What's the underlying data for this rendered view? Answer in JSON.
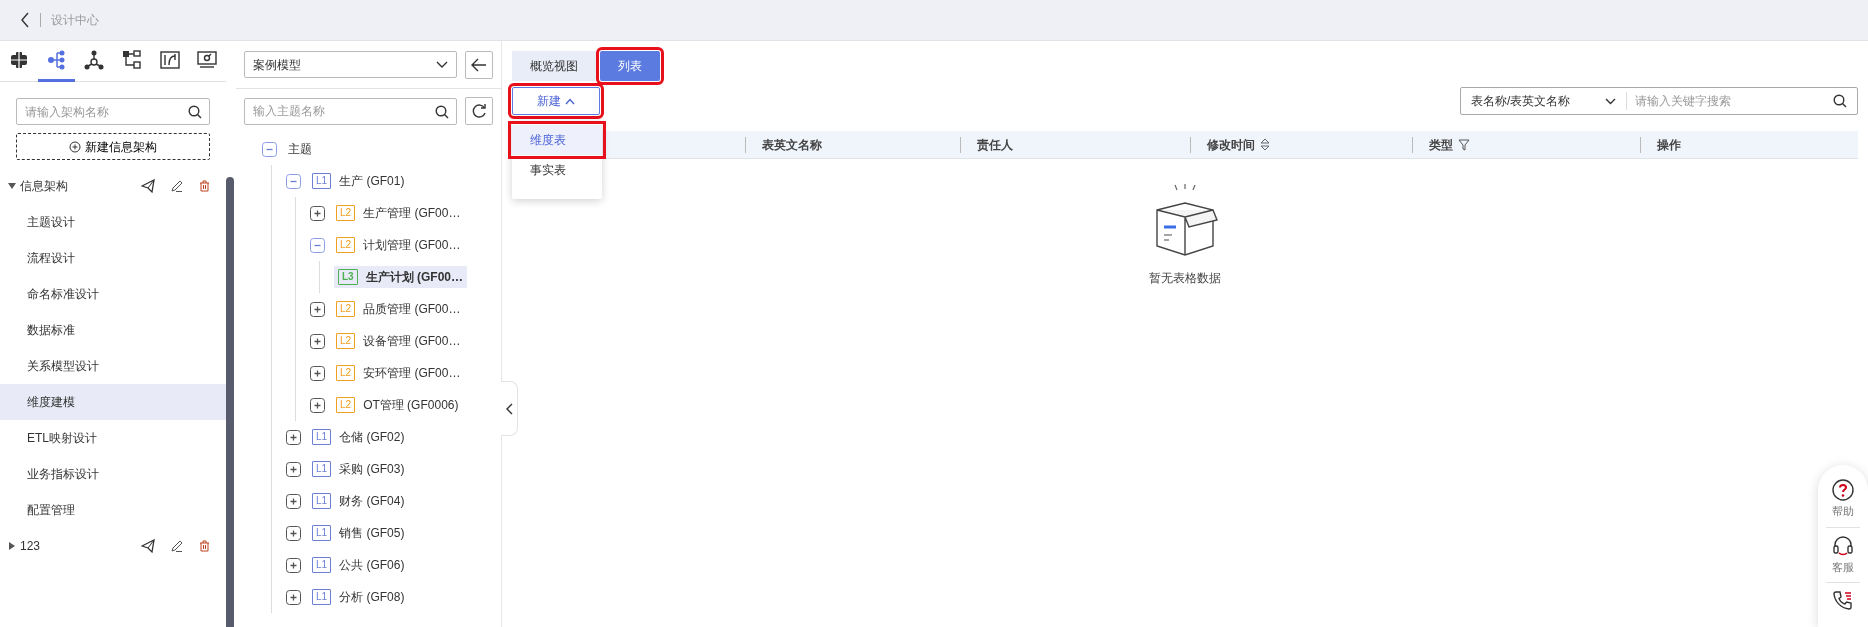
{
  "header": {
    "breadcrumb": "设计中心"
  },
  "sidebar": {
    "icon_tabs": [
      {
        "selected": false
      },
      {
        "selected": true
      },
      {
        "selected": false
      },
      {
        "selected": false
      },
      {
        "selected": false
      },
      {
        "selected": false
      }
    ],
    "search": {
      "placeholder": "请输入架构名称"
    },
    "new_button": "新建信息架构",
    "architectures": [
      {
        "label": "信息架构",
        "expanded": true,
        "items": [
          {
            "label": "主题设计",
            "selected": false
          },
          {
            "label": "流程设计",
            "selected": false
          },
          {
            "label": "命名标准设计",
            "selected": false
          },
          {
            "label": "数据标准",
            "selected": false
          },
          {
            "label": "关系模型设计",
            "selected": false
          },
          {
            "label": "维度建模",
            "selected": true
          },
          {
            "label": "ETL映射设计",
            "selected": false
          },
          {
            "label": "业务指标设计",
            "selected": false
          },
          {
            "label": "配置管理",
            "selected": false
          }
        ]
      },
      {
        "label": "123",
        "expanded": false
      }
    ]
  },
  "subject_panel": {
    "model_select": "案例模型",
    "search": {
      "placeholder": "输入主题名称"
    },
    "tree": [
      {
        "label": "主题",
        "expanded": true,
        "selected": false,
        "children": [
          {
            "label": "生产 (GF01)",
            "level": "L1",
            "expanded": true,
            "selected": false,
            "children": [
              {
                "label": "生产管理 (GF00…",
                "level": "L2",
                "expanded": false,
                "selected": false
              },
              {
                "label": "计划管理 (GF00…",
                "level": "L2",
                "expanded": true,
                "selected": false,
                "children": [
                  {
                    "label": "生产计划 (GF00…",
                    "level": "L3",
                    "selected": true
                  }
                ]
              },
              {
                "label": "品质管理 (GF00…",
                "level": "L2",
                "expanded": false,
                "selected": false
              },
              {
                "label": "设备管理 (GF00…",
                "level": "L2",
                "expanded": false,
                "selected": false
              },
              {
                "label": "安环管理 (GF00…",
                "level": "L2",
                "expanded": false,
                "selected": false
              },
              {
                "label": "OT管理 (GF0006)",
                "level": "L2",
                "expanded": false,
                "selected": false
              }
            ]
          },
          {
            "label": "仓储 (GF02)",
            "level": "L1",
            "expanded": false,
            "selected": false
          },
          {
            "label": "采购 (GF03)",
            "level": "L1",
            "expanded": false,
            "selected": false
          },
          {
            "label": "财务 (GF04)",
            "level": "L1",
            "expanded": false,
            "selected": false
          },
          {
            "label": "销售 (GF05)",
            "level": "L1",
            "expanded": false,
            "selected": false
          },
          {
            "label": "公共 (GF06)",
            "level": "L1",
            "expanded": false,
            "selected": false
          },
          {
            "label": "分析 (GF08)",
            "level": "L1",
            "expanded": false,
            "selected": false
          }
        ]
      }
    ]
  },
  "content": {
    "tabs": [
      {
        "label": "概览视图",
        "selected": false,
        "highlighted": false
      },
      {
        "label": "列表",
        "selected": true,
        "highlighted": true
      }
    ],
    "new_button": {
      "label": "新建",
      "expanded": true,
      "highlighted": true
    },
    "new_menu": [
      {
        "label": "维度表",
        "selected": true,
        "highlighted": true
      },
      {
        "label": "事实表",
        "selected": false,
        "highlighted": false
      }
    ],
    "filter": {
      "field": "表名称/表英文名称",
      "placeholder": "请输入关键字搜索"
    },
    "table": {
      "columns": [
        {
          "label": "表英文名称",
          "kind": "plain"
        },
        {
          "label": "责任人",
          "kind": "plain"
        },
        {
          "label": "修改时间",
          "kind": "sortable"
        },
        {
          "label": "类型",
          "kind": "filterable"
        },
        {
          "label": "操作",
          "kind": "plain"
        }
      ],
      "empty_text": "暂无表格数据"
    }
  },
  "help_widget": {
    "items": [
      {
        "label": "帮助",
        "kind": "help"
      },
      {
        "label": "客服",
        "kind": "service"
      },
      {
        "kind": "phone"
      }
    ]
  }
}
